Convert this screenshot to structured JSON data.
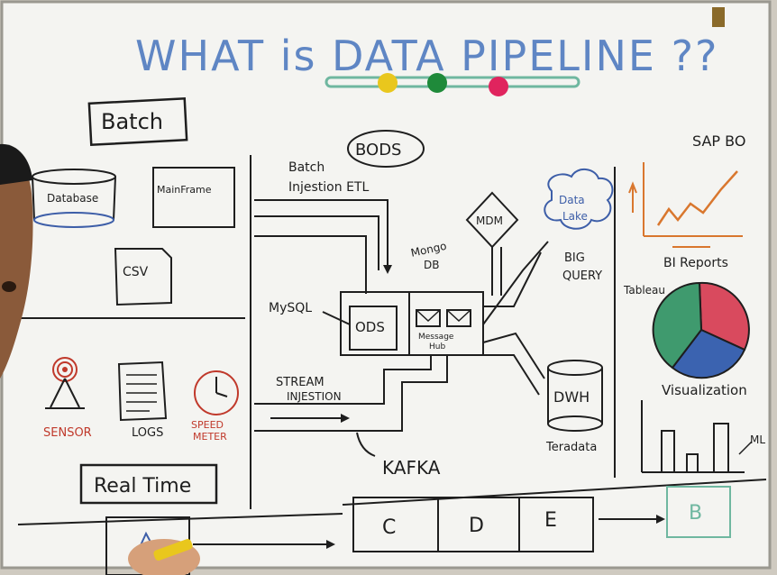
{
  "title": "WHAT is DATA PIPELINE ??",
  "colors": {
    "board": "#f4f4f1",
    "ink": "#1e1e1e",
    "title_blue": "#5f86c4",
    "red_ink": "#c0392b",
    "orange_line": "#d9772e",
    "pie_red": "#d94a5e",
    "pie_green": "#3f9a6e",
    "pie_blue": "#3b63b0",
    "ball_yellow": "#e9c71d",
    "ball_green": "#1f8a3a",
    "ball_pink": "#e0245e",
    "bar_green": "#7fbfa0"
  },
  "left": {
    "batch_label": "Batch",
    "database": "Database",
    "mainframe": "MainFrame",
    "csv": "CSV",
    "sensor": "SENSOR",
    "logs": "LOGS",
    "speedometer_line1": "SPEED",
    "speedometer_line2": "METER",
    "realtime_label": "Real Time"
  },
  "middle": {
    "bods": "BODS",
    "batch_ingestion_line1": "Batch",
    "batch_ingestion_line2": "Injestion ETL",
    "mongodb_line1": "Mongo",
    "mongodb_line2": "DB",
    "mdm": "MDM",
    "data_lake_line1": "Data",
    "data_lake_line2": "Lake",
    "big_query_line1": "BIG",
    "big_query_line2": "QUERY",
    "mysql": "MySQL",
    "ods": "ODS",
    "message_hub_line1": "Message",
    "message_hub_line2": "Hub",
    "stream_ingestion_line1": "STREAM",
    "stream_ingestion_line2": "INJESTION",
    "dwh": "DWH",
    "teradata": "Teradata",
    "kafka": "KAFKA"
  },
  "right": {
    "sap_bo": "SAP BO",
    "bi_reports": "BI Reports",
    "tableau": "Tableau",
    "visualization": "Visualization",
    "ml": "ML"
  },
  "bottom": {
    "boxes": [
      "C",
      "D",
      "E"
    ],
    "b_box": "B"
  }
}
